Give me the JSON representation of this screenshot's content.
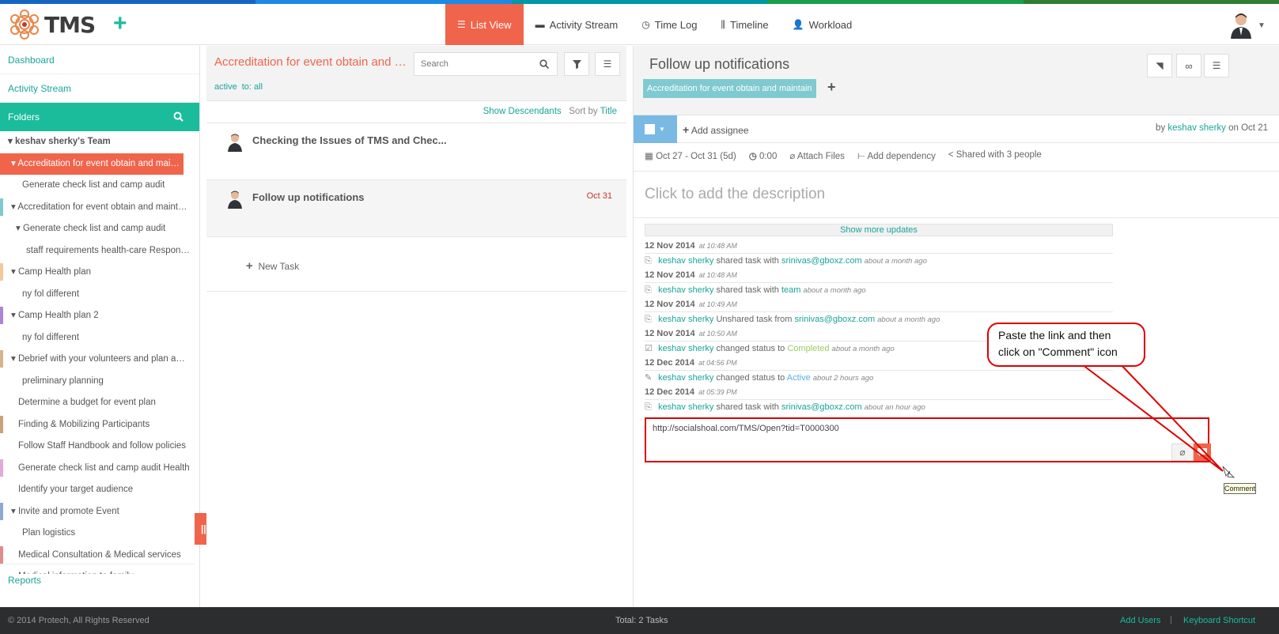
{
  "top_stripe_colors": [
    "#1565c0",
    "#1e88e5",
    "#0097a7",
    "#1b9e4b",
    "#2e7d32"
  ],
  "header": {
    "logo_text": "TMS",
    "add_icon": "plus-icon",
    "tabs": [
      {
        "label": "List View",
        "icon": "list-icon",
        "active": true
      },
      {
        "label": "Activity Stream",
        "icon": "comment-icon"
      },
      {
        "label": "Time Log",
        "icon": "clock-icon"
      },
      {
        "label": "Timeline",
        "icon": "sliders-icon"
      },
      {
        "label": "Workload",
        "icon": "user-icon"
      }
    ]
  },
  "sidebar": {
    "dashboard": "Dashboard",
    "activity_stream": "Activity Stream",
    "folders": "Folders",
    "reports": "Reports",
    "items": [
      {
        "label": "keshav sherky's Team",
        "kind": "team",
        "indent": 10,
        "caret": true
      },
      {
        "label": "Accreditation for event obtain and maintain",
        "indent": 14,
        "caret": true,
        "active": true,
        "color": "#f0644b"
      },
      {
        "label": "Generate check list and camp audit",
        "indent": 28
      },
      {
        "label": "Accreditation for event obtain and maintain",
        "indent": 14,
        "caret": true,
        "color": "#7fcad0"
      },
      {
        "label": "Generate check list and camp audit",
        "indent": 20,
        "caret": true
      },
      {
        "label": "staff requirements health-care Responsibilities",
        "indent": 33
      },
      {
        "label": "Camp Health plan",
        "indent": 14,
        "caret": true,
        "color": "#f6c89a"
      },
      {
        "label": "ny fol different",
        "indent": 28
      },
      {
        "label": "Camp Health plan 2",
        "indent": 14,
        "caret": true,
        "color": "#a885d6"
      },
      {
        "label": "ny fol different",
        "indent": 28
      },
      {
        "label": "Debrief with your volunteers and plan ahead",
        "indent": 14,
        "caret": true,
        "color": "#d9b38c"
      },
      {
        "label": "preliminary planning",
        "indent": 28
      },
      {
        "label": "Determine a budget for event plan",
        "indent": 23
      },
      {
        "label": "Finding & Mobilizing Participants",
        "indent": 23,
        "color": "#c9a27a"
      },
      {
        "label": "Follow Staff Handbook and follow policies",
        "indent": 23
      },
      {
        "label": "Generate check list and camp audit Health",
        "indent": 23,
        "color": "#e6a9d6"
      },
      {
        "label": "Identify your target audience",
        "indent": 23
      },
      {
        "label": "Invite and promote Event",
        "indent": 14,
        "caret": true,
        "color": "#8fa8d6"
      },
      {
        "label": "Plan logistics",
        "indent": 28
      },
      {
        "label": "Medical Consultation & Medical services",
        "indent": 23,
        "color": "#e58a8a"
      },
      {
        "label": "Medical information to family",
        "indent": 23
      }
    ]
  },
  "middle": {
    "title": "Accreditation for event obtain and maintain",
    "search_placeholder": "Search",
    "filters": [
      "active",
      "to: all"
    ],
    "show_descendants": "Show Descendants",
    "sort_prefix": "Sort by",
    "sort_field": "Title",
    "tasks": [
      {
        "name": "Checking the Issues of TMS and Chec...",
        "date": ""
      },
      {
        "name": "Follow up notifications",
        "date": "Oct 31"
      }
    ],
    "new_task": "New Task"
  },
  "detail": {
    "title": "Follow up notifications",
    "folder_tag": "Accreditation for event obtain and maintain",
    "add_assignee": "Add assignee",
    "by_prefix": "by",
    "author": "keshav sherky",
    "on_date": "on Oct 21",
    "dates": "Oct 27 - Oct 31 (5d)",
    "time": "0:00",
    "attach_files": "Attach Files",
    "add_dependency": "Add dependency",
    "shared": "Shared with 3 people",
    "description_placeholder": "Click to add the description",
    "show_more": "Show more updates",
    "updates": [
      {
        "date": "12 Nov 2014",
        "time": "at 10:48 AM",
        "user": "keshav sherky",
        "action": "shared task with",
        "target": "srinivas@gboxz.com",
        "target_style": "lnk",
        "ago": "about a month ago",
        "icon": "share"
      },
      {
        "date": "12 Nov 2014",
        "time": "at 10:48 AM",
        "user": "keshav sherky",
        "action": "shared task with",
        "target": "team",
        "target_style": "lnk",
        "ago": "about a month ago",
        "icon": "share"
      },
      {
        "date": "12 Nov 2014",
        "time": "at 10:49 AM",
        "user": "keshav sherky",
        "action": "Unshared task from",
        "target": "srinivas@gboxz.com",
        "target_style": "lnk",
        "ago": "about a month ago",
        "icon": "share"
      },
      {
        "date": "12 Nov 2014",
        "time": "at 10:50 AM",
        "user": "keshav sherky",
        "action": "changed status to",
        "target": "Completed",
        "target_style": "green",
        "ago": "about a month ago",
        "icon": "check"
      },
      {
        "date": "12 Dec 2014",
        "time": "at 04:56 PM",
        "user": "keshav sherky",
        "action": "changed status to",
        "target": "Active",
        "target_style": "blue",
        "ago": "about 2 hours ago",
        "icon": "edit"
      },
      {
        "date": "12 Dec 2014",
        "time": "at 05:39 PM",
        "user": "keshav sherky",
        "action": "shared task with",
        "target": "srinivas@gboxz.com",
        "target_style": "lnk",
        "ago": "about an hour ago",
        "icon": "share"
      }
    ],
    "comment_value": "http://socialshoal.com/TMS/Open?tid=T0000300",
    "comment_tooltip": "Comment"
  },
  "callout": {
    "line1": "Paste the link and then",
    "line2": "click on \"Comment\" icon"
  },
  "footer": {
    "copyright": "© 2014 Protech, All Rights Reserved",
    "total": "Total: 2 Tasks",
    "add_users": "Add Users",
    "separator": "|",
    "keyboard_shortcut": "Keyboard Shortcut"
  }
}
